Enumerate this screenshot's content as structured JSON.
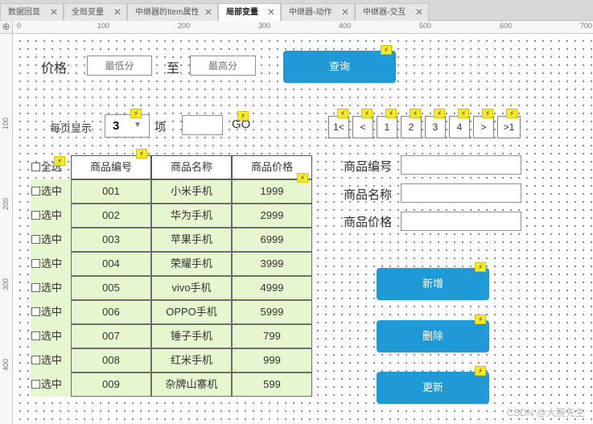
{
  "tabs": [
    {
      "label": "数据回显"
    },
    {
      "label": "全局变量"
    },
    {
      "label": "中继器的Item属性"
    },
    {
      "label": "局部变量",
      "active": true
    },
    {
      "label": "中继器-动作"
    },
    {
      "label": "中继器-交互"
    }
  ],
  "ruler": {
    "h": [
      "0",
      "100",
      "200",
      "300",
      "400",
      "500",
      "600",
      "700"
    ],
    "v": [
      "100",
      "200",
      "300",
      "400"
    ]
  },
  "filter": {
    "price_label": "价格",
    "min_placeholder": "最低分",
    "to_label": "至",
    "max_placeholder": "最高分",
    "query_button": "查询"
  },
  "paging": {
    "per_page_label": "每页显示",
    "per_page_value": "3",
    "item_label": "项",
    "go_label": "GO",
    "buttons": [
      "1<",
      "<",
      "1",
      "2",
      "3",
      "4",
      ">",
      ">1"
    ]
  },
  "table": {
    "select_all": "全选",
    "select_row": "选中",
    "headers": [
      "商品编号",
      "商品名称",
      "商品价格"
    ],
    "rows": [
      [
        "001",
        "小米手机",
        "1999"
      ],
      [
        "002",
        "华为手机",
        "2999"
      ],
      [
        "003",
        "苹果手机",
        "6999"
      ],
      [
        "004",
        "荣耀手机",
        "3999"
      ],
      [
        "005",
        "vivo手机",
        "4999"
      ],
      [
        "006",
        "OPPO手机",
        "5999"
      ],
      [
        "007",
        "锤子手机",
        "799"
      ],
      [
        "008",
        "红米手机",
        "999"
      ],
      [
        "009",
        "杂牌山寨机",
        "599"
      ]
    ]
  },
  "form": {
    "code_label": "商品编号",
    "name_label": "商品名称",
    "price_label": "商品价格",
    "add_button": "新增",
    "delete_button": "删除",
    "update_button": "更新"
  },
  "icons": {
    "interaction": "lightning-bolt-icon",
    "dropdown": "triangle-down-icon"
  },
  "colors": {
    "button": "#1f9ad6",
    "row_bg": "#e6f7cf",
    "bolt": "#f7ea2b"
  },
  "watermark": "CSDN @大腕先生"
}
